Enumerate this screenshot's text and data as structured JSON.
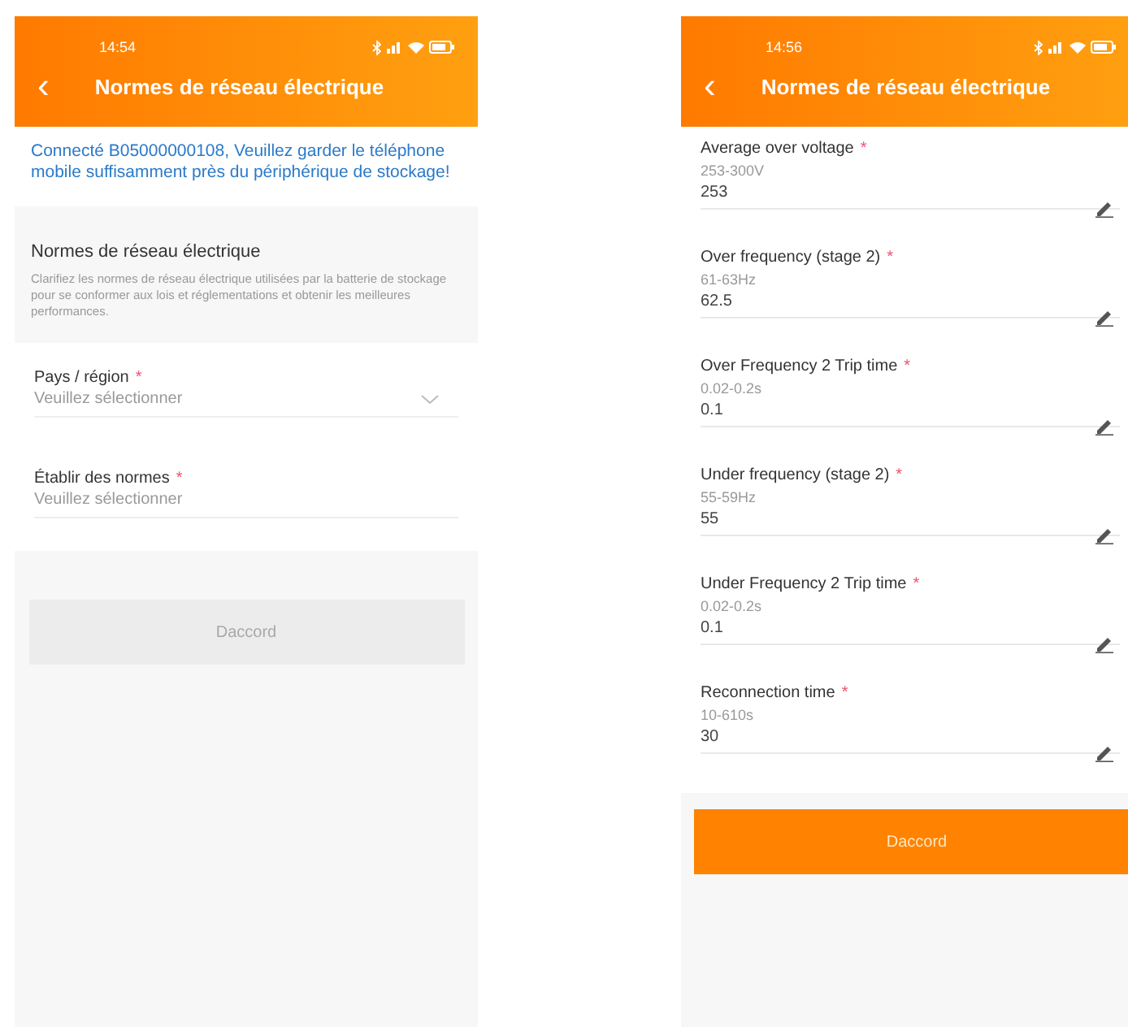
{
  "screens": [
    {
      "status_time": "14:54",
      "title": "Normes de réseau électrique",
      "back": "‹",
      "notice": "Connecté B05000000108, Veuillez garder le téléphone mobile suffisamment près du périphérique de stockage!",
      "section": {
        "heading": "Normes de réseau électrique",
        "description": "Clarifiez les normes de réseau électrique utilisées par la batterie de stockage pour se conformer aux lois et réglementations et obtenir les meilleures performances."
      },
      "fields": [
        {
          "kind": "select",
          "label": "Pays / région",
          "required_mark": "*",
          "placeholder": "Veuillez sélectionner",
          "chevron": true
        },
        {
          "kind": "select",
          "label": "Établir des normes",
          "required_mark": "*",
          "placeholder": "Veuillez sélectionner",
          "chevron": false
        }
      ],
      "button": {
        "label": "Daccord",
        "disabled": true
      }
    },
    {
      "status_time": "14:56",
      "title": "Normes de réseau électrique",
      "back": "‹",
      "fields": [
        {
          "kind": "input",
          "label": "Average over voltage",
          "required_mark": "*",
          "range": "253-300V",
          "value": "253"
        },
        {
          "kind": "input",
          "label": "Over frequency (stage 2)",
          "required_mark": "*",
          "range": "61-63Hz",
          "value": "62.5"
        },
        {
          "kind": "input",
          "label": "Over Frequency 2 Trip time",
          "required_mark": "*",
          "range": "0.02-0.2s",
          "value": "0.1"
        },
        {
          "kind": "input",
          "label": "Under frequency (stage 2)",
          "required_mark": "*",
          "range": "55-59Hz",
          "value": "55"
        },
        {
          "kind": "input",
          "label": "Under Frequency 2 Trip time",
          "required_mark": "*",
          "range": "0.02-0.2s",
          "value": "0.1"
        },
        {
          "kind": "input",
          "label": "Reconnection time",
          "required_mark": "*",
          "range": "10-610s",
          "value": "30"
        }
      ],
      "button": {
        "label": "Daccord",
        "disabled": false
      }
    }
  ]
}
